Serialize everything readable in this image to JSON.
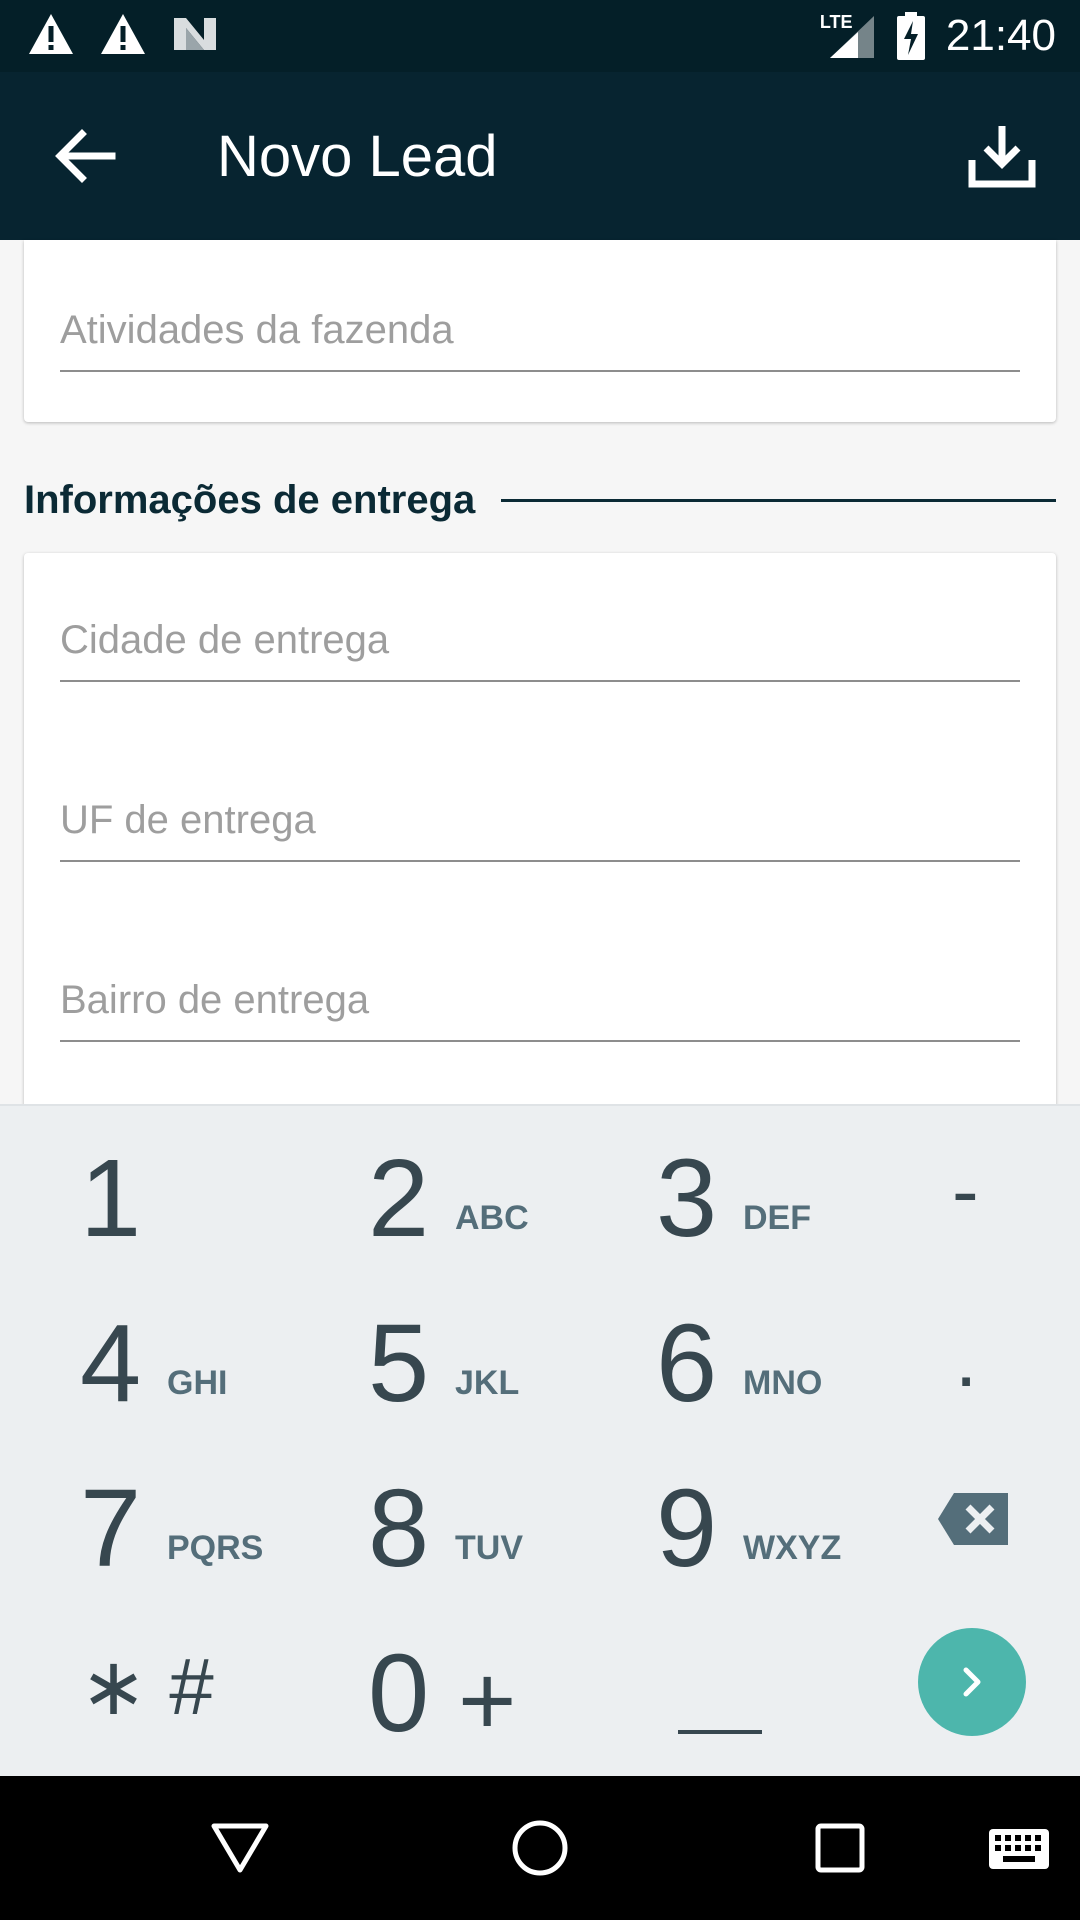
{
  "status_bar": {
    "time": "21:40",
    "network": "LTE",
    "icons": [
      "warning-icon",
      "warning-icon",
      "n-icon",
      "lte-signal-icon",
      "battery-charging-icon"
    ]
  },
  "app_bar": {
    "title": "Novo Lead",
    "icons": [
      "back-arrow-icon",
      "download-icon"
    ]
  },
  "form": {
    "field_atividades": {
      "placeholder": "Atividades da fazenda",
      "value": ""
    },
    "section_title": "Informações de entrega",
    "field_cidade": {
      "placeholder": "Cidade de entrega",
      "value": ""
    },
    "field_uf": {
      "placeholder": "UF de entrega",
      "value": ""
    },
    "field_bairro": {
      "placeholder": "Bairro de entrega",
      "value": ""
    }
  },
  "keyboard": {
    "keys": [
      {
        "digit": "1",
        "letters": ""
      },
      {
        "digit": "2",
        "letters": "ABC"
      },
      {
        "digit": "3",
        "letters": "DEF"
      },
      {
        "digit": "4",
        "letters": "GHI"
      },
      {
        "digit": "5",
        "letters": "JKL"
      },
      {
        "digit": "6",
        "letters": "MNO"
      },
      {
        "digit": "7",
        "letters": "PQRS"
      },
      {
        "digit": "8",
        "letters": "TUV"
      },
      {
        "digit": "9",
        "letters": "WXYZ"
      },
      {
        "digit": "0",
        "letters": "+"
      }
    ],
    "dash": "-",
    "dot": ".",
    "star_hash": "∗ #",
    "space": "",
    "accent_color": "#4db6ac",
    "icons": [
      "backspace-icon",
      "chevron-right-icon"
    ]
  },
  "nav_bar": {
    "icons": [
      "back-triangle-icon",
      "home-circle-icon",
      "recents-square-icon",
      "keyboard-icon"
    ]
  }
}
